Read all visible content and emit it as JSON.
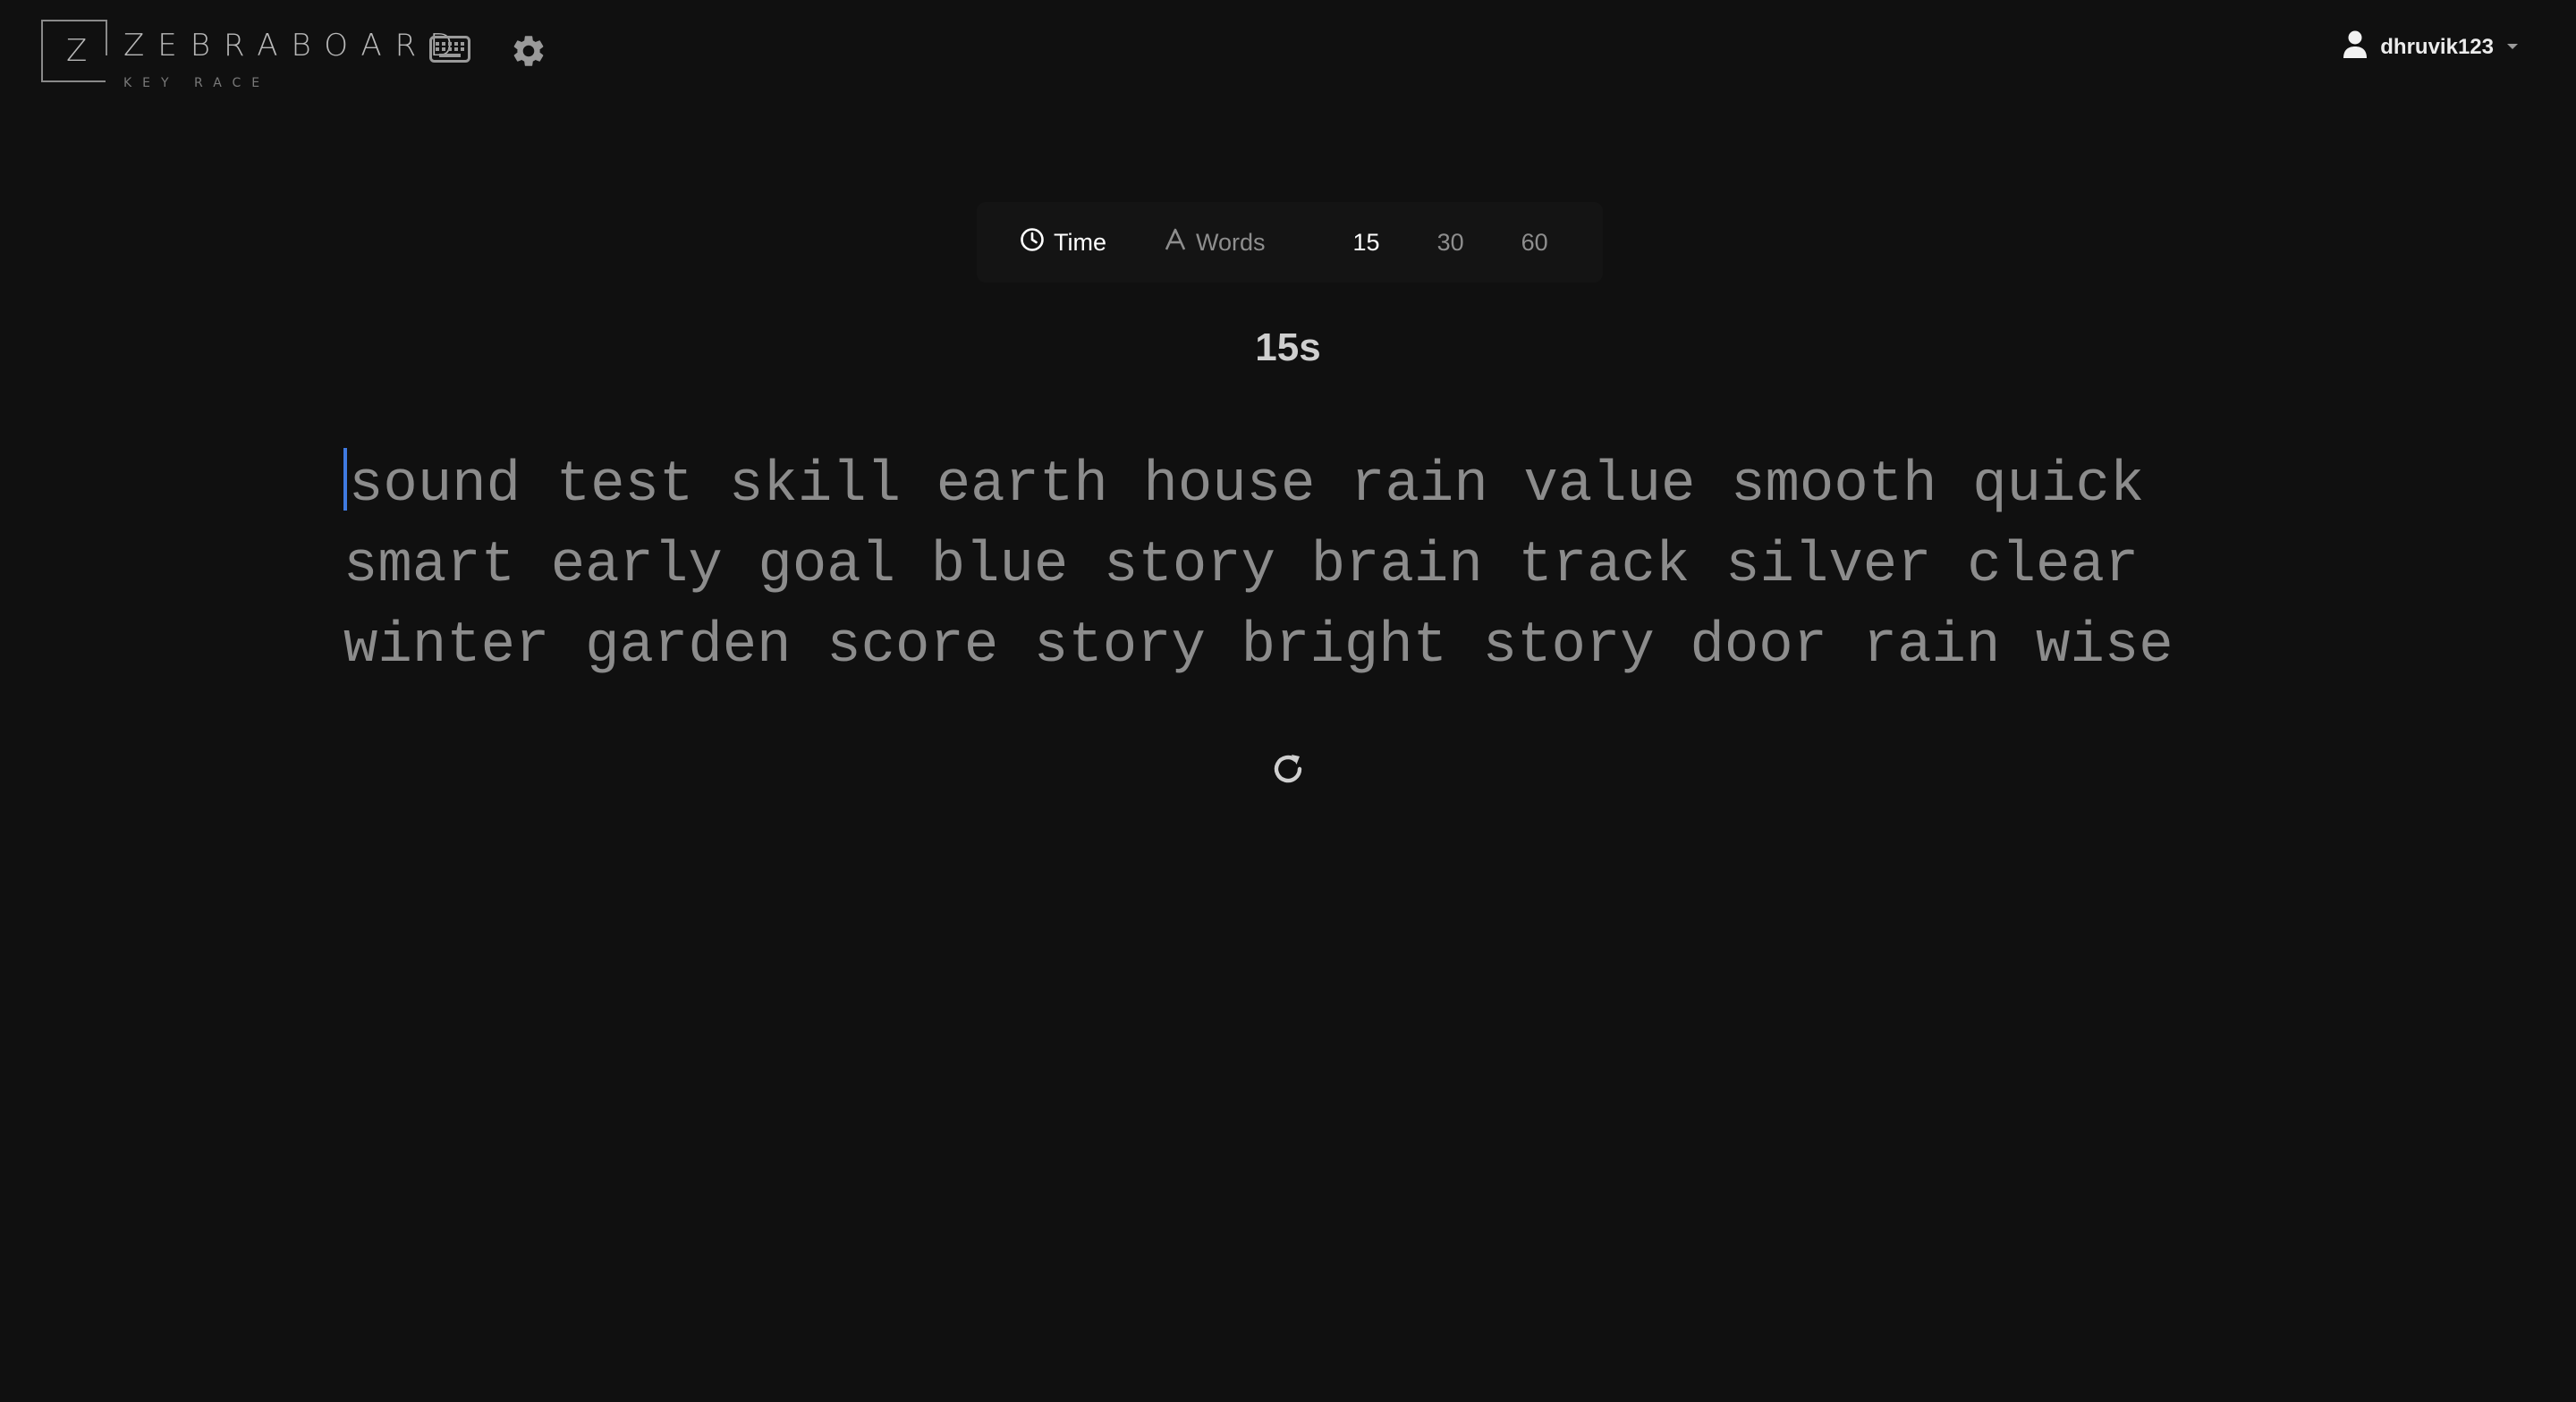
{
  "header": {
    "logo_letter": "Z",
    "logo_word": "ZEBRABOARD",
    "logo_tagline": "KEY RACE",
    "username": "dhruvik123"
  },
  "mode_bar": {
    "time_label": "Time",
    "words_label": "Words",
    "durations": [
      "15",
      "30",
      "60"
    ],
    "selected_mode": "Time",
    "selected_duration": "15"
  },
  "timer": {
    "text": "15s"
  },
  "words": {
    "lines": [
      [
        "sound",
        "test",
        "skill",
        "earth",
        "house",
        "rain",
        "value",
        "smooth",
        "quick"
      ],
      [
        "smart",
        "early",
        "goal",
        "blue",
        "story",
        "brain",
        "track",
        "silver",
        "clear"
      ],
      [
        "winter",
        "garden",
        "score",
        "story",
        "bright",
        "story",
        "door",
        "rain",
        "wise"
      ]
    ]
  },
  "colors": {
    "background": "#101010",
    "caret": "#3f7ae0",
    "text_pending": "#8c8c8c",
    "active": "#ffffff"
  }
}
